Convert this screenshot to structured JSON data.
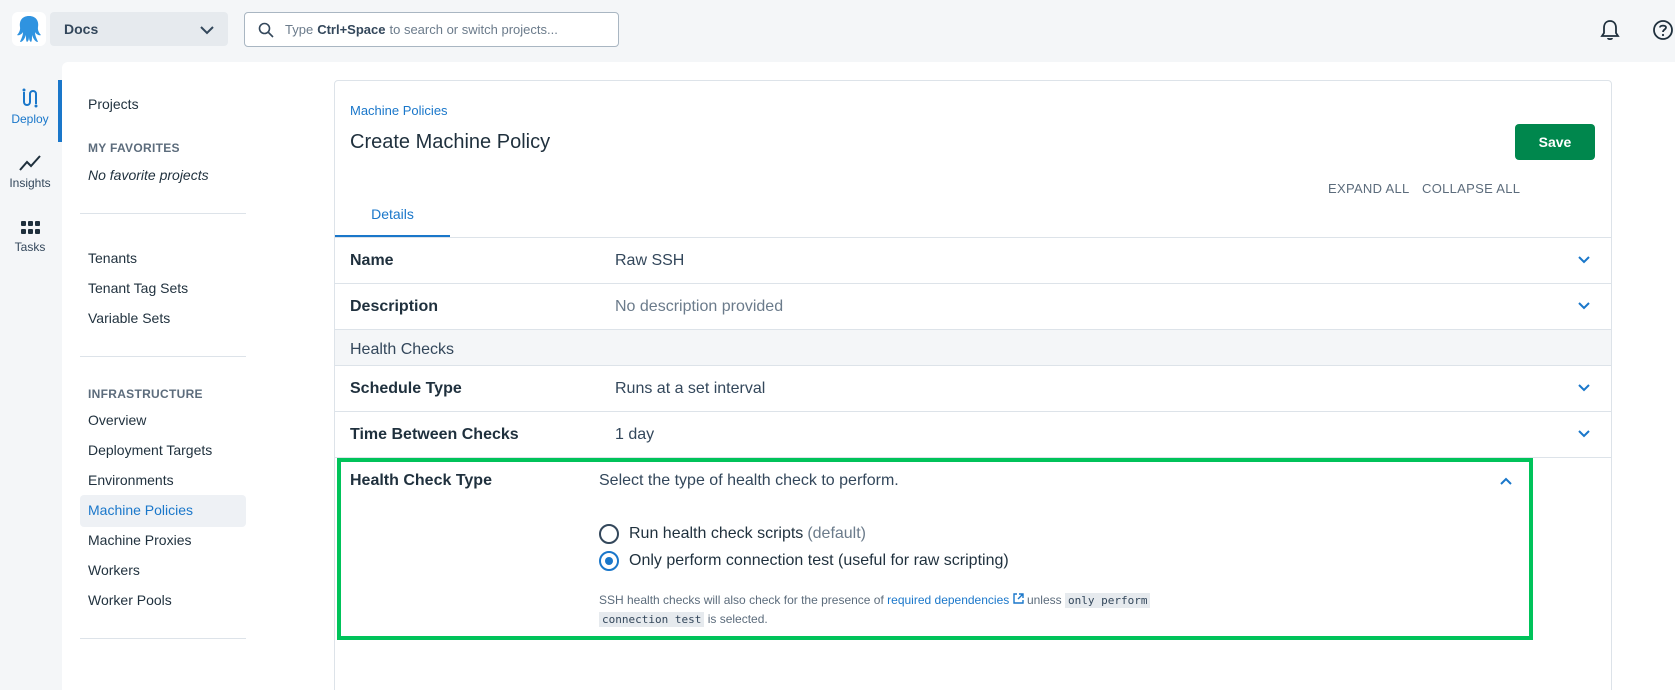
{
  "topbar": {
    "space_name": "Docs",
    "search_prefix": "Type",
    "search_shortcut": "Ctrl+Space",
    "search_suffix": "to search or switch projects..."
  },
  "rail": {
    "items": [
      {
        "label": "Deploy",
        "icon": "deploy-icon",
        "active": true
      },
      {
        "label": "Insights",
        "icon": "insights-icon",
        "active": false
      },
      {
        "label": "Tasks",
        "icon": "tasks-icon",
        "active": false
      }
    ]
  },
  "sidebar": {
    "projects": "Projects",
    "favorites_heading": "MY FAVORITES",
    "favorites_empty": "No favorite projects",
    "tenants": "Tenants",
    "tenant_tag_sets": "Tenant Tag Sets",
    "variable_sets": "Variable Sets",
    "infrastructure_heading": "INFRASTRUCTURE",
    "infrastructure_items": [
      "Overview",
      "Deployment Targets",
      "Environments",
      "Machine Policies",
      "Machine Proxies",
      "Workers",
      "Worker Pools"
    ],
    "active_item": "Machine Policies"
  },
  "page": {
    "breadcrumb": "Machine Policies",
    "title": "Create Machine Policy",
    "save_label": "Save",
    "expand_all": "EXPAND ALL",
    "collapse_all": "COLLAPSE ALL",
    "tab_details": "Details"
  },
  "form": {
    "name_label": "Name",
    "name_value": "Raw SSH",
    "description_label": "Description",
    "description_value": "No description provided",
    "section_health_checks": "Health Checks",
    "schedule_label": "Schedule Type",
    "schedule_value": "Runs at a set interval",
    "interval_label": "Time Between Checks",
    "interval_value": "1 day",
    "health_type_label": "Health Check Type",
    "health_type_help": "Select the type of health check to perform.",
    "option_scripts": "Run health check scripts",
    "option_scripts_note": "(default)",
    "option_connection": "Only perform connection test (useful for raw scripting)",
    "selected_option": "connection",
    "note_prefix": "SSH health checks will also check for the presence of",
    "note_link": "required dependencies",
    "note_middle": "unless",
    "note_code_1": "only perform",
    "note_code_2": "connection test",
    "note_suffix": "is selected."
  },
  "colors": {
    "accent": "#1a77ca",
    "save": "#00874d",
    "highlight": "#00c35a"
  }
}
